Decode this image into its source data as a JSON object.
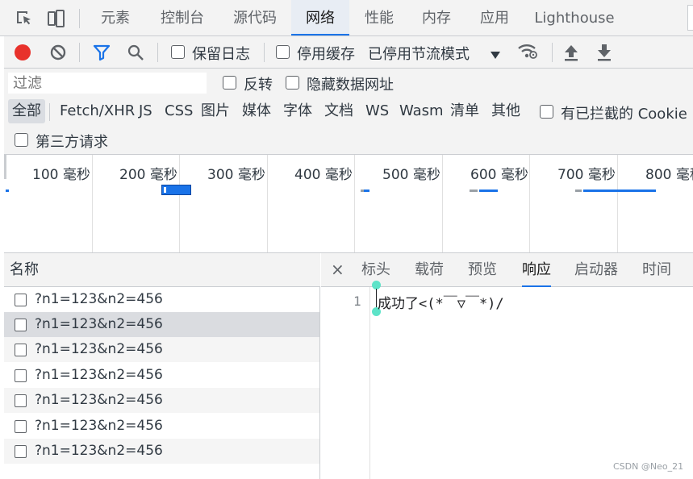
{
  "tabs": [
    "元素",
    "控制台",
    "源代码",
    "网络",
    "性能",
    "内存",
    "应用",
    "Lighthouse"
  ],
  "active_tab": "网络",
  "toolbar": {
    "preserve_log": "保留日志",
    "disable_cache": "停用缓存",
    "throttle": "已停用节流模式"
  },
  "filter": {
    "placeholder": "过滤",
    "invert": "反转",
    "hide_data_urls": "隐藏数据网址",
    "types": [
      "全部",
      "Fetch/XHR",
      "JS",
      "CSS",
      "图片",
      "媒体",
      "字体",
      "文档",
      "WS",
      "Wasm",
      "清单",
      "其他"
    ],
    "blocked_cookies": "有已拦截的 Cookie",
    "third_party": "第三方请求"
  },
  "timeline": {
    "ticks": [
      "100 毫秒",
      "200 毫秒",
      "300 毫秒",
      "400 毫秒",
      "500 毫秒",
      "600 毫秒",
      "700 毫秒",
      "800 毫秒"
    ]
  },
  "list": {
    "header": "名称",
    "rows": [
      "?n1=123&n2=456",
      "?n1=123&n2=456",
      "?n1=123&n2=456",
      "?n1=123&n2=456",
      "?n1=123&n2=456",
      "?n1=123&n2=456",
      "?n1=123&n2=456"
    ],
    "selected_index": 1
  },
  "detail": {
    "close": "×",
    "tabs": [
      "标头",
      "载荷",
      "预览",
      "响应",
      "启动器",
      "时间"
    ],
    "active_tab": "响应",
    "line_number": "1",
    "response": "成功了<(*￣▽￣*)/"
  },
  "watermark": "CSDN @Neo_21",
  "colors": {
    "record": "#e8312b",
    "accent": "#1a73e8",
    "filter_icon": "#1a73e8"
  }
}
